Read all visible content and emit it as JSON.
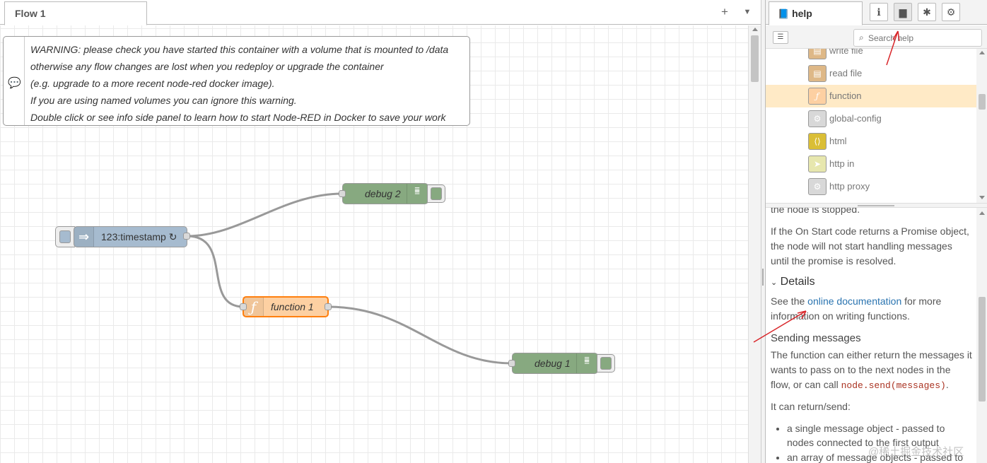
{
  "workspace": {
    "tab_label": "Flow 1",
    "add_icon": "plus-icon",
    "menu_icon": "chevron-down-icon"
  },
  "comment": {
    "lines": [
      "WARNING: please check you have started this container with a volume that is mounted to /data",
      "otherwise any flow changes are lost when you redeploy or upgrade the container",
      "(e.g. upgrade to a more recent node-red docker image).",
      "If you are using named volumes you can ignore this warning.",
      "Double click or see info side panel to learn how to start Node-RED in Docker to save your work"
    ]
  },
  "nodes": {
    "inject": {
      "label": "123:timestamp ↻",
      "color": "#a6bbcf"
    },
    "function": {
      "label": "function 1",
      "color": "#fdd0a2",
      "icon": "ƒ"
    },
    "debug1": {
      "label": "debug 1",
      "color": "#87a980"
    },
    "debug2": {
      "label": "debug 2",
      "color": "#87a980"
    }
  },
  "sidebar": {
    "help_tab_label": "help",
    "buttons": [
      "info-icon",
      "book-icon",
      "bug-icon",
      "gear-icon"
    ],
    "search_placeholder": "Search help",
    "palette_items": [
      {
        "label": "write file",
        "color": "#deb887",
        "selected": false
      },
      {
        "label": "read file",
        "color": "#deb887",
        "selected": false
      },
      {
        "label": "function",
        "color": "#fdd0a2",
        "selected": true
      },
      {
        "label": "global-config",
        "color": "#d8d8d8",
        "selected": false
      },
      {
        "label": "html",
        "color": "#dabe36",
        "selected": false
      },
      {
        "label": "http in",
        "color": "#e7e7ae",
        "selected": false
      },
      {
        "label": "http proxy",
        "color": "#d8d8d8",
        "selected": false
      }
    ],
    "help": {
      "cut_line": "the node is stopped.",
      "promise_text": "If the On Start code returns a Promise object, the node will not start handling messages until the promise is resolved.",
      "details_heading": "Details",
      "see_the": "See the",
      "doc_link": "online documentation",
      "doc_rest": "for more information on writing functions.",
      "sending_heading": "Sending messages",
      "sending_text_1": "The function can either return the messages it wants to pass on to the next nodes in the flow, or can call",
      "sending_code": "node.send(messages)",
      "sending_text_2": ".",
      "return_text": "It can return/send:",
      "bullets": [
        "a single message object - passed to nodes connected to the first output",
        "an array of message objects - passed to"
      ]
    }
  },
  "watermark": "@稀土掘金技术社区"
}
